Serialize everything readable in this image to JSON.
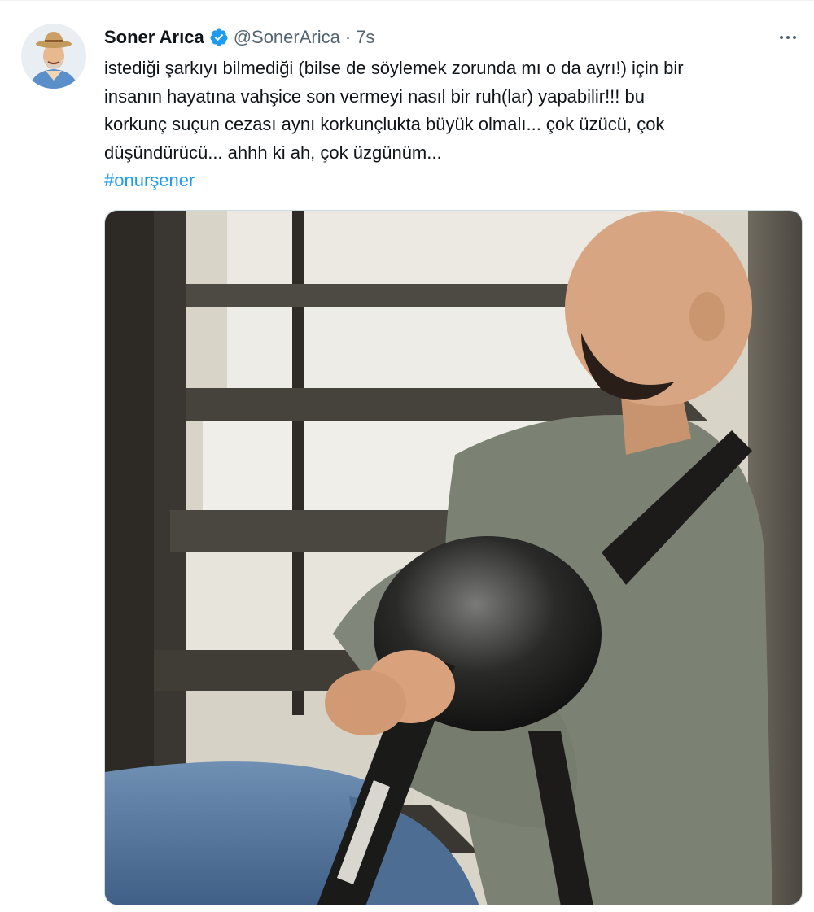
{
  "tweet": {
    "author_name": "Soner Arıca",
    "handle": "@SonerArica",
    "separator": "·",
    "time": "7s",
    "verified_icon": "verified-badge-icon",
    "more_icon": "more-options-icon",
    "text_lines": [
      "istediği şarkıyı bilmediği (bilse de söylemek zorunda mı o da ayrı!) için bir",
      "insanın hayatına vahşice son vermeyi nasıl bir ruh(lar) yapabilir!!! bu",
      "korkunç suçun cezası aynı korkunçlukta büyük olmalı... çok üzücü, çok",
      "düşündürücü... ahhh ki ah, çok üzgünüm..."
    ],
    "hashtag": "#onurşener",
    "colors": {
      "link": "#1d9bf0",
      "verified": "#1d9bf0",
      "secondary_text": "#536471",
      "primary_text": "#0f1419"
    }
  }
}
